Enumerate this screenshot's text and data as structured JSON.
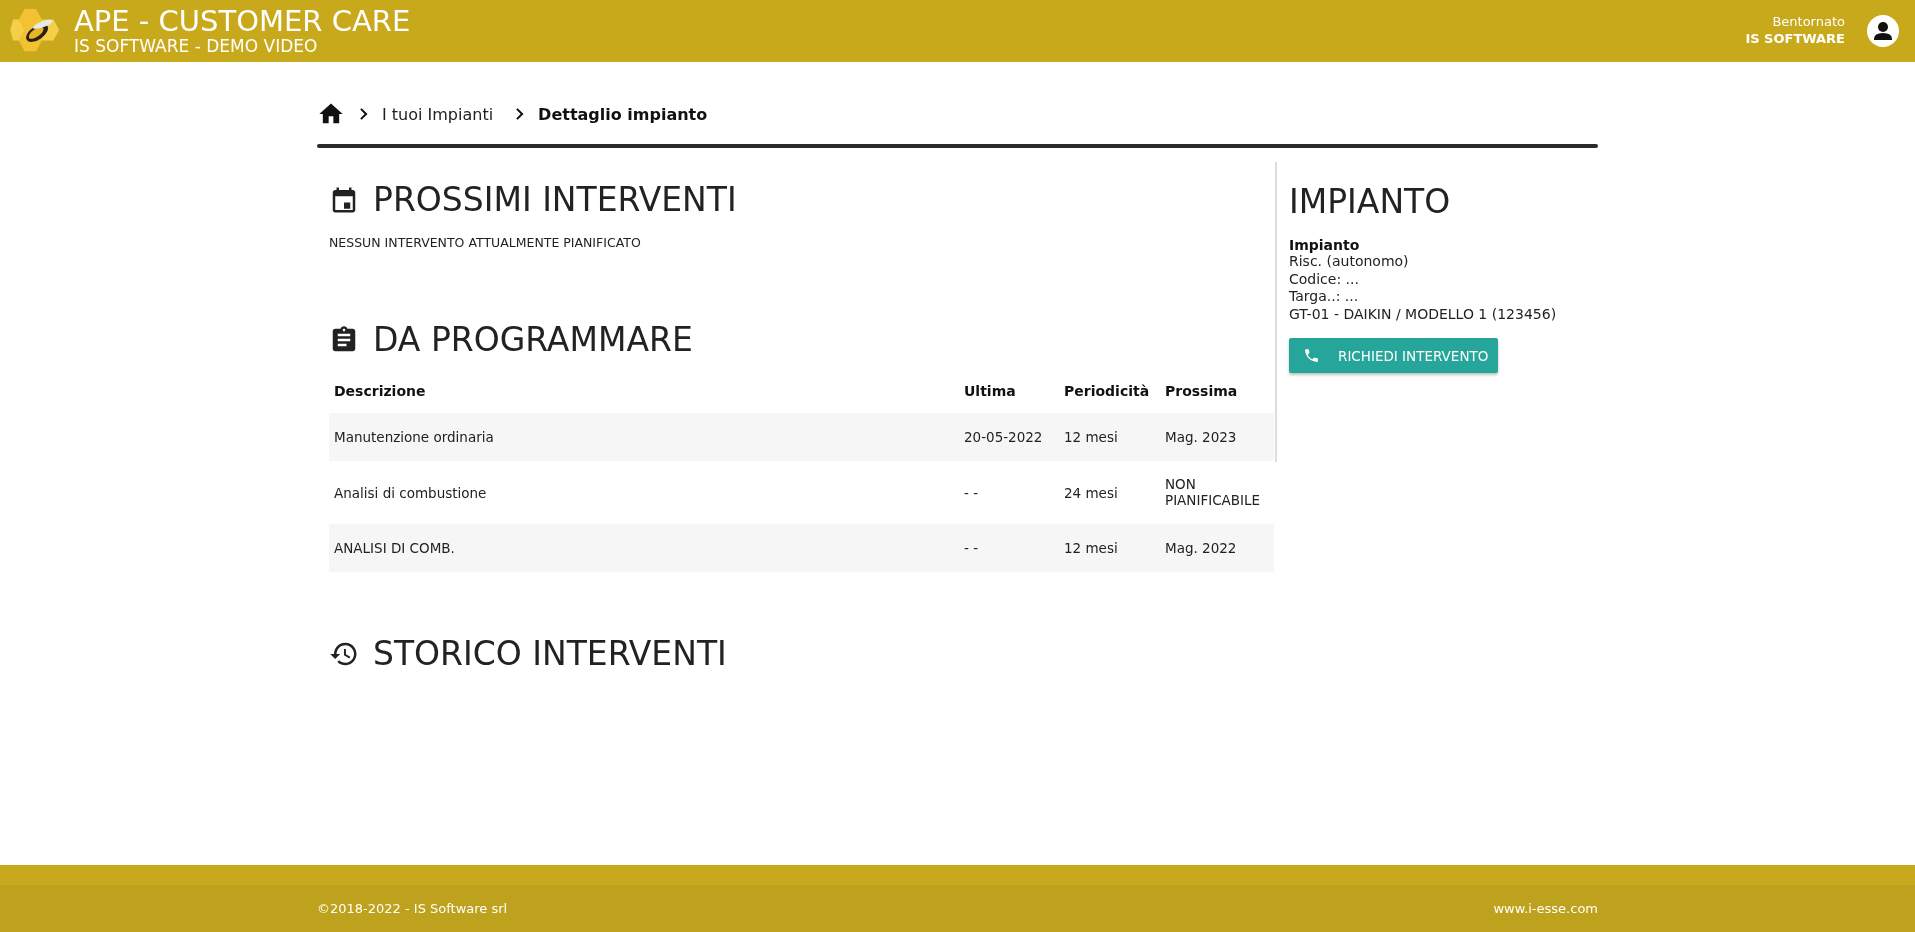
{
  "header": {
    "title": "APE - CUSTOMER CARE",
    "subtitle": "IS SOFTWARE - DEMO VIDEO",
    "greeting": "Bentornato",
    "user": "IS SOFTWARE"
  },
  "breadcrumb": [
    {
      "label": "I tuoi Impianti",
      "current": false
    },
    {
      "label": "Dettaglio impianto",
      "current": true
    }
  ],
  "upcoming": {
    "title": "PROSSIMI INTERVENTI",
    "message": "NESSUN INTERVENTO ATTUALMENTE PIANIFICATO"
  },
  "to_schedule": {
    "title": "DA PROGRAMMARE",
    "columns": [
      "Descrizione",
      "Ultima",
      "Periodicità",
      "Prossima"
    ],
    "rows": [
      [
        "Manutenzione ordinaria",
        "20-05-2022",
        "12 mesi",
        "Mag. 2023"
      ],
      [
        "Analisi di combustione",
        "- -",
        "24 mesi",
        "NON PIANIFICABILE"
      ],
      [
        "ANALISI DI COMB.",
        "- -",
        "12 mesi",
        "Mag. 2022"
      ]
    ]
  },
  "history": {
    "title": "STORICO INTERVENTI"
  },
  "plant": {
    "title": "IMPIANTO",
    "label": "Impianto",
    "lines": [
      "Risc. (autonomo)",
      "Codice: ...",
      "Targa..: ...",
      "GT-01 - DAIKIN / MODELLO 1 (123456)"
    ],
    "button": "RICHIEDI INTERVENTO"
  },
  "footer": {
    "copyright": "©2018-2022 - IS Software srl",
    "link": "www.i-esse.com"
  }
}
